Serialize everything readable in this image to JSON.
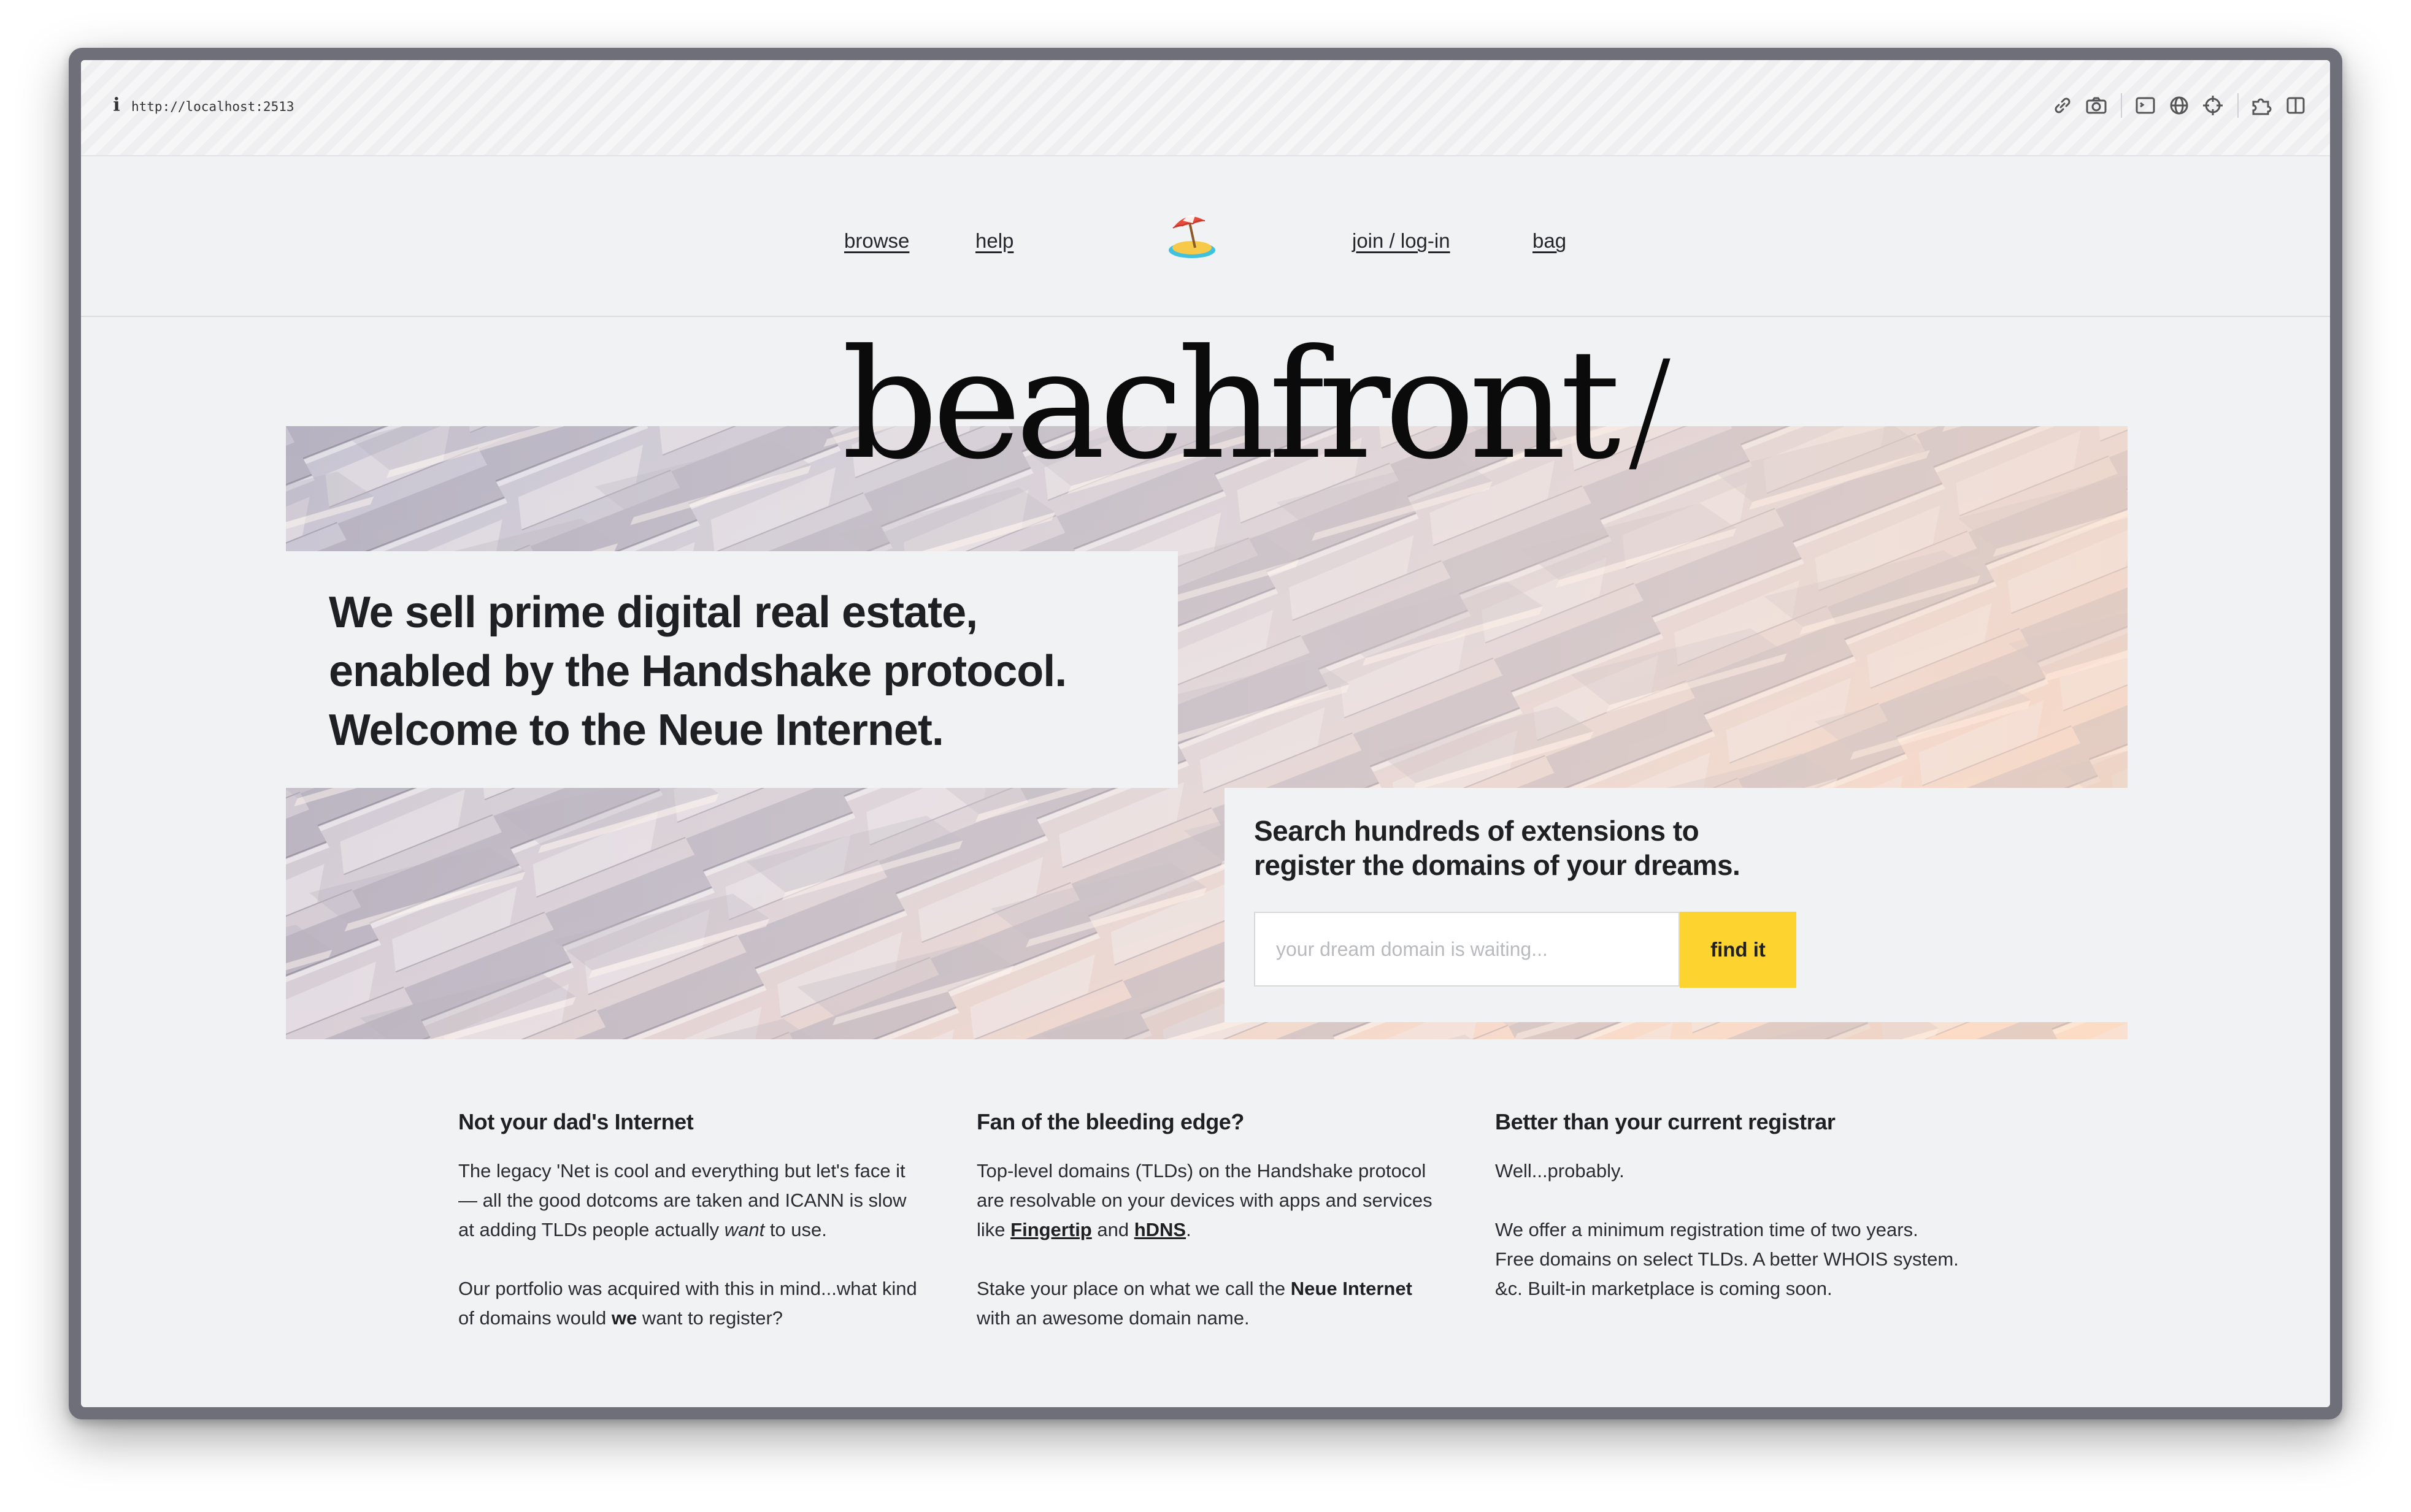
{
  "browser": {
    "url": "http://localhost:2513",
    "tools": [
      "link-icon",
      "camera-icon",
      "terminal-icon",
      "globe-icon",
      "crosshair-icon",
      "extension-icon",
      "sidebar-icon"
    ]
  },
  "nav": {
    "browse": "browse",
    "help": "help",
    "join": "join / log-in",
    "bag": "bag",
    "logo": "beach-umbrella-icon"
  },
  "hero": {
    "wordmark": "beachfront",
    "wordmark_slash": "/",
    "tagline_1": "We sell prime digital real estate,",
    "tagline_2": "enabled by the Handshake protocol.",
    "tagline_3": "Welcome to the Neue Internet."
  },
  "search": {
    "heading_1": "Search hundreds of extensions to",
    "heading_2": "register the domains of your dreams.",
    "placeholder": "your dream domain is waiting...",
    "value": "",
    "button": "find it"
  },
  "features": {
    "col1": {
      "title": "Not your dad's Internet",
      "p1_a": "The legacy 'Net is cool and everything but let's face it — all the good dotcoms are taken and ICANN is slow at adding TLDs people actually ",
      "p1_em": "want",
      "p1_b": " to use.",
      "p2_a": "Our portfolio was acquired with this in mind...what kind of domains would ",
      "p2_strong": "we",
      "p2_b": " want to register?"
    },
    "col2": {
      "title": "Fan of the bleeding edge?",
      "p1_a": "Top-level domains (TLDs) on the Handshake protocol are resolvable on your devices with apps and services like ",
      "link1": "Fingertip",
      "p1_and": " and ",
      "link2": "hDNS",
      "p1_end": ".",
      "p2_a": "Stake your place on what we call the ",
      "p2_strong": "Neue Internet",
      "p2_b": " with an awesome domain name."
    },
    "col3": {
      "title": "Better than your current registrar",
      "p1": "Well...probably.",
      "p2": "We offer a minimum registration time of two years. Free domains on select TLDs. A better WHOIS system. &c. Built-in marketplace is coming soon."
    }
  },
  "colors": {
    "page_bg": "#f1f2f4",
    "accent_button": "#fdd32f",
    "text": "#1e2024"
  }
}
